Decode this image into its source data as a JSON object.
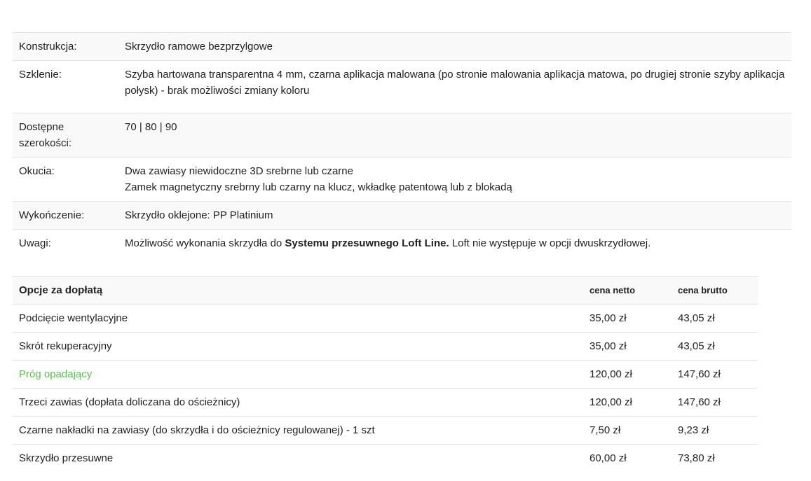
{
  "specs": [
    {
      "label": "Konstrukcja:",
      "lines": [
        "Skrzydło ramowe bezprzylgowe"
      ]
    },
    {
      "label": "Szklenie:",
      "lines": [
        "Szyba hartowana transparentna 4 mm, czarna aplikacja malowana (po stronie malowania aplikacja matowa, po drugiej stronie szyby aplikacja połysk) - brak możliwości zmiany koloru"
      ]
    },
    {
      "label": "Dostępne szerokości:",
      "lines": [
        "70 | 80 | 90"
      ]
    },
    {
      "label": "Okucia:",
      "lines": [
        "Dwa zawiasy niewidoczne 3D srebrne lub czarne",
        "Zamek magnetyczny srebrny lub czarny na klucz, wkładkę patentową lub z blokadą"
      ]
    },
    {
      "label": "Wykończenie:",
      "lines": [
        "Skrzydło oklejone: PP Platinium"
      ]
    },
    {
      "label": "Uwagi:",
      "pre": "Możliwość wykonania skrzydła do ",
      "bold": "Systemu przesuwnego Loft Line.",
      "post": " Loft nie występuje w opcji dwuskrzydłowej."
    }
  ],
  "options": {
    "header": {
      "name": "Opcje za dopłatą",
      "netto": "cena netto",
      "brutto": "cena brutto"
    },
    "rows": [
      {
        "name": "Podcięcie wentylacyjne",
        "netto": "35,00 zł",
        "brutto": "43,05 zł",
        "link": false
      },
      {
        "name": "Skrót rekuperacyjny",
        "netto": "35,00 zł",
        "brutto": "43,05 zł",
        "link": false
      },
      {
        "name": "Próg opadający",
        "netto": "120,00 zł",
        "brutto": "147,60 zł",
        "link": true
      },
      {
        "name": "Trzeci zawias (dopłata doliczana do ościeżnicy)",
        "netto": "120,00 zł",
        "brutto": "147,60 zł",
        "link": false
      },
      {
        "name": "Czarne nakładki na zawiasy (do skrzydła i do ościeżnicy regulowanej) - 1 szt",
        "netto": "7,50 zł",
        "brutto": "9,23 zł",
        "link": false
      },
      {
        "name": "Skrzydło przesuwne",
        "netto": "60,00 zł",
        "brutto": "73,80 zł",
        "link": false
      }
    ]
  },
  "colors": {
    "link": "#5bbf4f",
    "stripe": "#f9f9f9",
    "border": "#e2e2e2"
  }
}
